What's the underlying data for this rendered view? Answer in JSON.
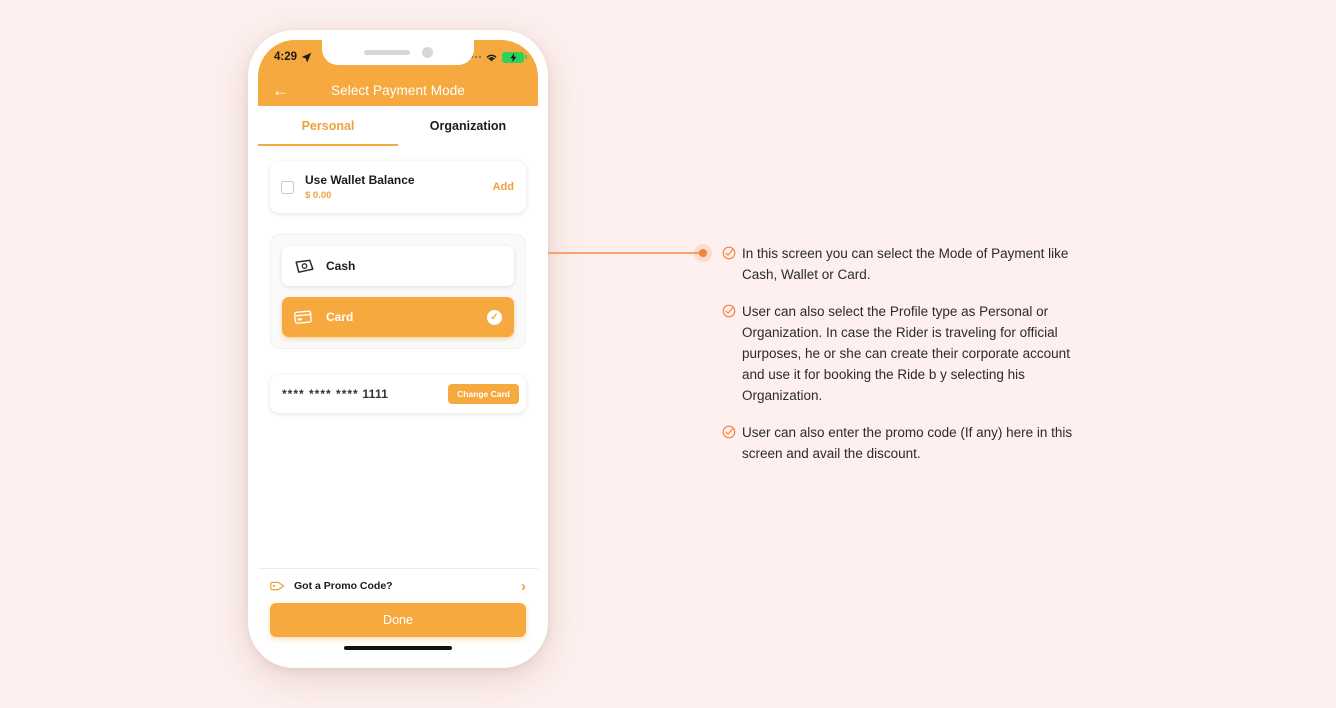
{
  "colors": {
    "background": "#fdf0ee",
    "accent": "#f5a93f",
    "accent_text": "#f0a03c",
    "connector": "#f3823e",
    "battery": "#2fd15b"
  },
  "phone": {
    "status_bar": {
      "time": "4:29",
      "location_icon": "location-arrow-icon",
      "signal_icon": "signal-dots-icon",
      "wifi_icon": "wifi-icon",
      "battery_icon": "battery-charging-icon",
      "battery_glyph": "⚡"
    },
    "app_bar": {
      "back_icon": "←",
      "title": "Select Payment Mode"
    },
    "tabs": [
      {
        "label": "Personal",
        "active": true
      },
      {
        "label": "Organization",
        "active": false
      }
    ],
    "wallet": {
      "title": "Use Wallet Balance",
      "amount": "$ 0.00",
      "add_label": "Add",
      "checkbox_checked": false
    },
    "payment_options": [
      {
        "label": "Cash",
        "icon": "cash-icon",
        "selected": false
      },
      {
        "label": "Card",
        "icon": "credit-card-icon",
        "selected": true,
        "check_glyph": "✓"
      }
    ],
    "saved_card": {
      "masked_digits": "**** **** ****",
      "last_four": "1111",
      "change_label": "Change Card"
    },
    "bottom": {
      "promo_icon": "tag-icon",
      "promo_label": "Got a Promo Code?",
      "chevron_glyph": "›",
      "done_label": "Done"
    }
  },
  "annotations": {
    "bullet_icon": "circle-check-icon",
    "notes": [
      "In this screen you can select the Mode of Payment like Cash, Wallet or Card.",
      "User can also select the Profile type as Personal or Organization. In case the Rider is traveling for official purposes, he or she can create their corporate account and use it for booking the Ride b y selecting his Organization.",
      "User can also enter the promo code (If any) here in this screen and avail the discount."
    ]
  }
}
